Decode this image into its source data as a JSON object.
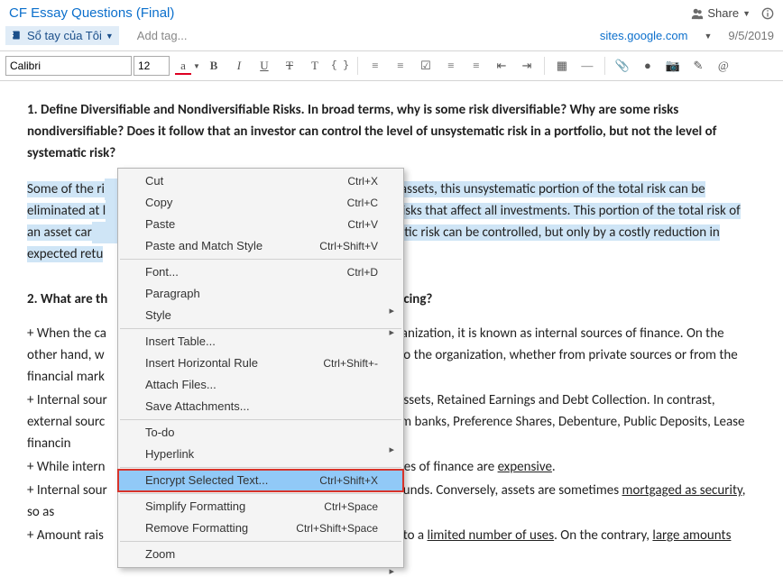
{
  "header": {
    "title": "CF Essay Questions (Final)",
    "share_label": "Share",
    "notebook_label": "Sổ tay của Tôi",
    "add_tag_placeholder": "Add tag...",
    "site_link": "sites.google.com",
    "date": "9/5/2019"
  },
  "toolbar": {
    "font": "Calibri",
    "size": "12",
    "buttons": {
      "font_color": "a",
      "bold": "B",
      "italic": "I",
      "underline": "U",
      "strike": "T",
      "superscript": "T",
      "code": "{ }",
      "bullets": "≡",
      "numbers": "≡",
      "checkbox": "☑",
      "align_left": "≡",
      "align_center": "≡",
      "outdent": "⇤",
      "indent": "⇥",
      "table": "▦",
      "hr": "—",
      "attach": "📎",
      "record": "●",
      "camera": "📷",
      "annotate": "✎",
      "at": "@"
    }
  },
  "doc": {
    "q1": "1. Define Diversifiable and Nondiversifiable Risks. In broad terms, why is some risk diversifiable? Why are some risks nondiversifiable? Does it follow that an investor can control the level of unsystematic risk in a portfolio, but not the level of systematic risk?",
    "p1_a": "Some of the ri",
    "p1_b": "f assets, this unsystematic portion of the total risk can be eliminated at l",
    "p1_c": " risks that affect all investments. This portion of the total risk of an asset car",
    "p1_d": "ematic risk can be controlled, but only by a costly reduction in expected retu",
    "q2_before": "2. What are th",
    "q2_after": "ncing?",
    "l1_a": "+ When the ca",
    "l1_b": "ganization, it is known as internal sources of finance. On the other hand, w",
    "l1_c": "l to the organization, whether from private sources or from the financial mark",
    "l2_a": "+ Internal sour",
    "l2_b": "Assets, Retained Earnings and Debt Collection. In contrast, external sourc",
    "l2_c": "om banks, Preference Shares, Debenture, Public Deposits, Lease financin",
    "l3_a": "+ While intern",
    "l3_b": "rces of finance are ",
    "l3_c": "expensive",
    "l3_d": ".",
    "l4_a": "+ Internal sour",
    "l4_b": " funds. Conversely, assets are sometimes ",
    "l4_c": "mortgaged as ",
    "l4_d": "security",
    "l4_e": ", so as",
    "l5_a": "+ Amount rais",
    "l5_b": "it to a ",
    "l5_c": "limited number of uses",
    "l5_d": ". On the contrary, ",
    "l5_e": "large amounts"
  },
  "context_menu": {
    "items": [
      {
        "label": "Cut",
        "shortcut": "Ctrl+X",
        "sub": false
      },
      {
        "label": "Copy",
        "shortcut": "Ctrl+C",
        "sub": false
      },
      {
        "label": "Paste",
        "shortcut": "Ctrl+V",
        "sub": false
      },
      {
        "label": "Paste and Match Style",
        "shortcut": "Ctrl+Shift+V",
        "sub": false
      },
      {
        "sep": true
      },
      {
        "label": "Font...",
        "shortcut": "Ctrl+D",
        "sub": false
      },
      {
        "label": "Paragraph",
        "shortcut": "",
        "sub": true
      },
      {
        "label": "Style",
        "shortcut": "",
        "sub": true
      },
      {
        "sep": true
      },
      {
        "label": "Insert Table...",
        "shortcut": "",
        "sub": false
      },
      {
        "label": "Insert Horizontal Rule",
        "shortcut": "Ctrl+Shift+-",
        "sub": false
      },
      {
        "label": "Attach Files...",
        "shortcut": "",
        "sub": false
      },
      {
        "label": "Save Attachments...",
        "shortcut": "",
        "sub": false
      },
      {
        "sep": true
      },
      {
        "label": "To-do",
        "shortcut": "",
        "sub": true
      },
      {
        "label": "Hyperlink",
        "shortcut": "",
        "sub": true
      },
      {
        "sep": true
      },
      {
        "label": "Encrypt Selected Text...",
        "shortcut": "Ctrl+Shift+X",
        "sub": false,
        "selected": true
      },
      {
        "sep": true
      },
      {
        "label": "Simplify Formatting",
        "shortcut": "Ctrl+Space",
        "sub": false
      },
      {
        "label": "Remove Formatting",
        "shortcut": "Ctrl+Shift+Space",
        "sub": false
      },
      {
        "sep": true
      },
      {
        "label": "Zoom",
        "shortcut": "",
        "sub": true
      }
    ]
  }
}
